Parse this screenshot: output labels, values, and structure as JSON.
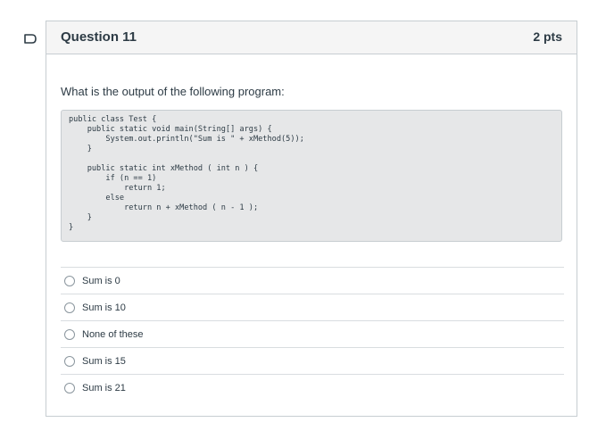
{
  "question": {
    "title": "Question 11",
    "points": "2 pts",
    "text": "What is the output of the following program:",
    "code": "public class Test {\n    public static void main(String[] args) {\n        System.out.println(\"Sum is \" + xMethod(5));\n    }\n\n    public static int xMethod ( int n ) {\n        if (n == 1)\n            return 1;\n        else\n            return n + xMethod ( n - 1 );\n    }\n}",
    "answers": [
      {
        "label": "Sum is 0"
      },
      {
        "label": "Sum is 10"
      },
      {
        "label": "None of these"
      },
      {
        "label": "Sum is 15"
      },
      {
        "label": "Sum is 21"
      }
    ]
  },
  "colors": {
    "header_bg": "#f5f5f5",
    "border": "#c7cdd1",
    "code_bg": "#e6e7e8",
    "text": "#2d3b45"
  },
  "icons": {
    "flag": "bookmark-outline-icon",
    "radio": "radio-unchecked-icon"
  }
}
